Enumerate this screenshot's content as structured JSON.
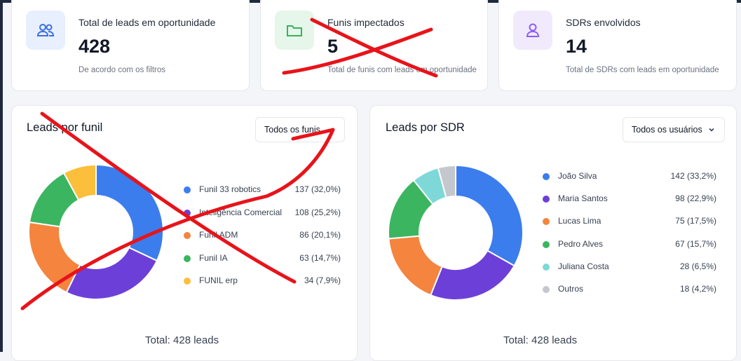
{
  "stats": [
    {
      "label": "Total de leads em oportunidade",
      "value": "428",
      "note": "De acordo com os filtros",
      "icon": "users-icon",
      "bg": "#e8efff",
      "color": "#3b6fe0"
    },
    {
      "label": "Funis impectados",
      "value": "5",
      "note": "Total de funis com leads em oportunidade",
      "icon": "folder-icon",
      "bg": "#e6f6ea",
      "color": "#36b35a"
    },
    {
      "label": "SDRs envolvidos",
      "value": "14",
      "note": "Total de SDRs com leads em oportunidade",
      "icon": "user-icon",
      "bg": "#f1eafd",
      "color": "#8b5cf6"
    }
  ],
  "funnel_panel": {
    "title": "Leads por funil",
    "filter_label": "Todos os funis",
    "total_label": "Total: 428 leads"
  },
  "sdr_panel": {
    "title": "Leads por SDR",
    "filter_label": "Todos os usuários",
    "total_label": "Total: 428 leads"
  },
  "chart_data": [
    {
      "type": "pie",
      "title": "Leads por funil",
      "categories": [
        "Funil 33 robotics",
        "Inteligência Comercial",
        "Funil ADM",
        "Funil IA",
        "FUNIL erp"
      ],
      "values": [
        137,
        108,
        86,
        63,
        34
      ],
      "value_labels": [
        "137 (32,0%)",
        "108 (25,2%)",
        "86 (20,1%)",
        "63 (14,7%)",
        "34 (7,9%)"
      ],
      "colors": [
        "#3b7ded",
        "#6d3fd9",
        "#f5843e",
        "#3bb560",
        "#fbbf3c"
      ],
      "legend": "right"
    },
    {
      "type": "pie",
      "title": "Leads por SDR",
      "categories": [
        "João Silva",
        "Maria Santos",
        "Lucas Lima",
        "Pedro Alves",
        "Juliana Costa",
        "Outros"
      ],
      "values": [
        142,
        98,
        75,
        67,
        28,
        18
      ],
      "value_labels": [
        "142 (33,2%)",
        "98 (22,9%)",
        "75 (17,5%)",
        "67 (15,7%)",
        "28  (6,5%)",
        "18  (4,2%)"
      ],
      "colors": [
        "#3b7ded",
        "#6d3fd9",
        "#f5843e",
        "#3bb560",
        "#7fd8d8",
        "#c4c8ce"
      ],
      "legend": "right"
    }
  ]
}
